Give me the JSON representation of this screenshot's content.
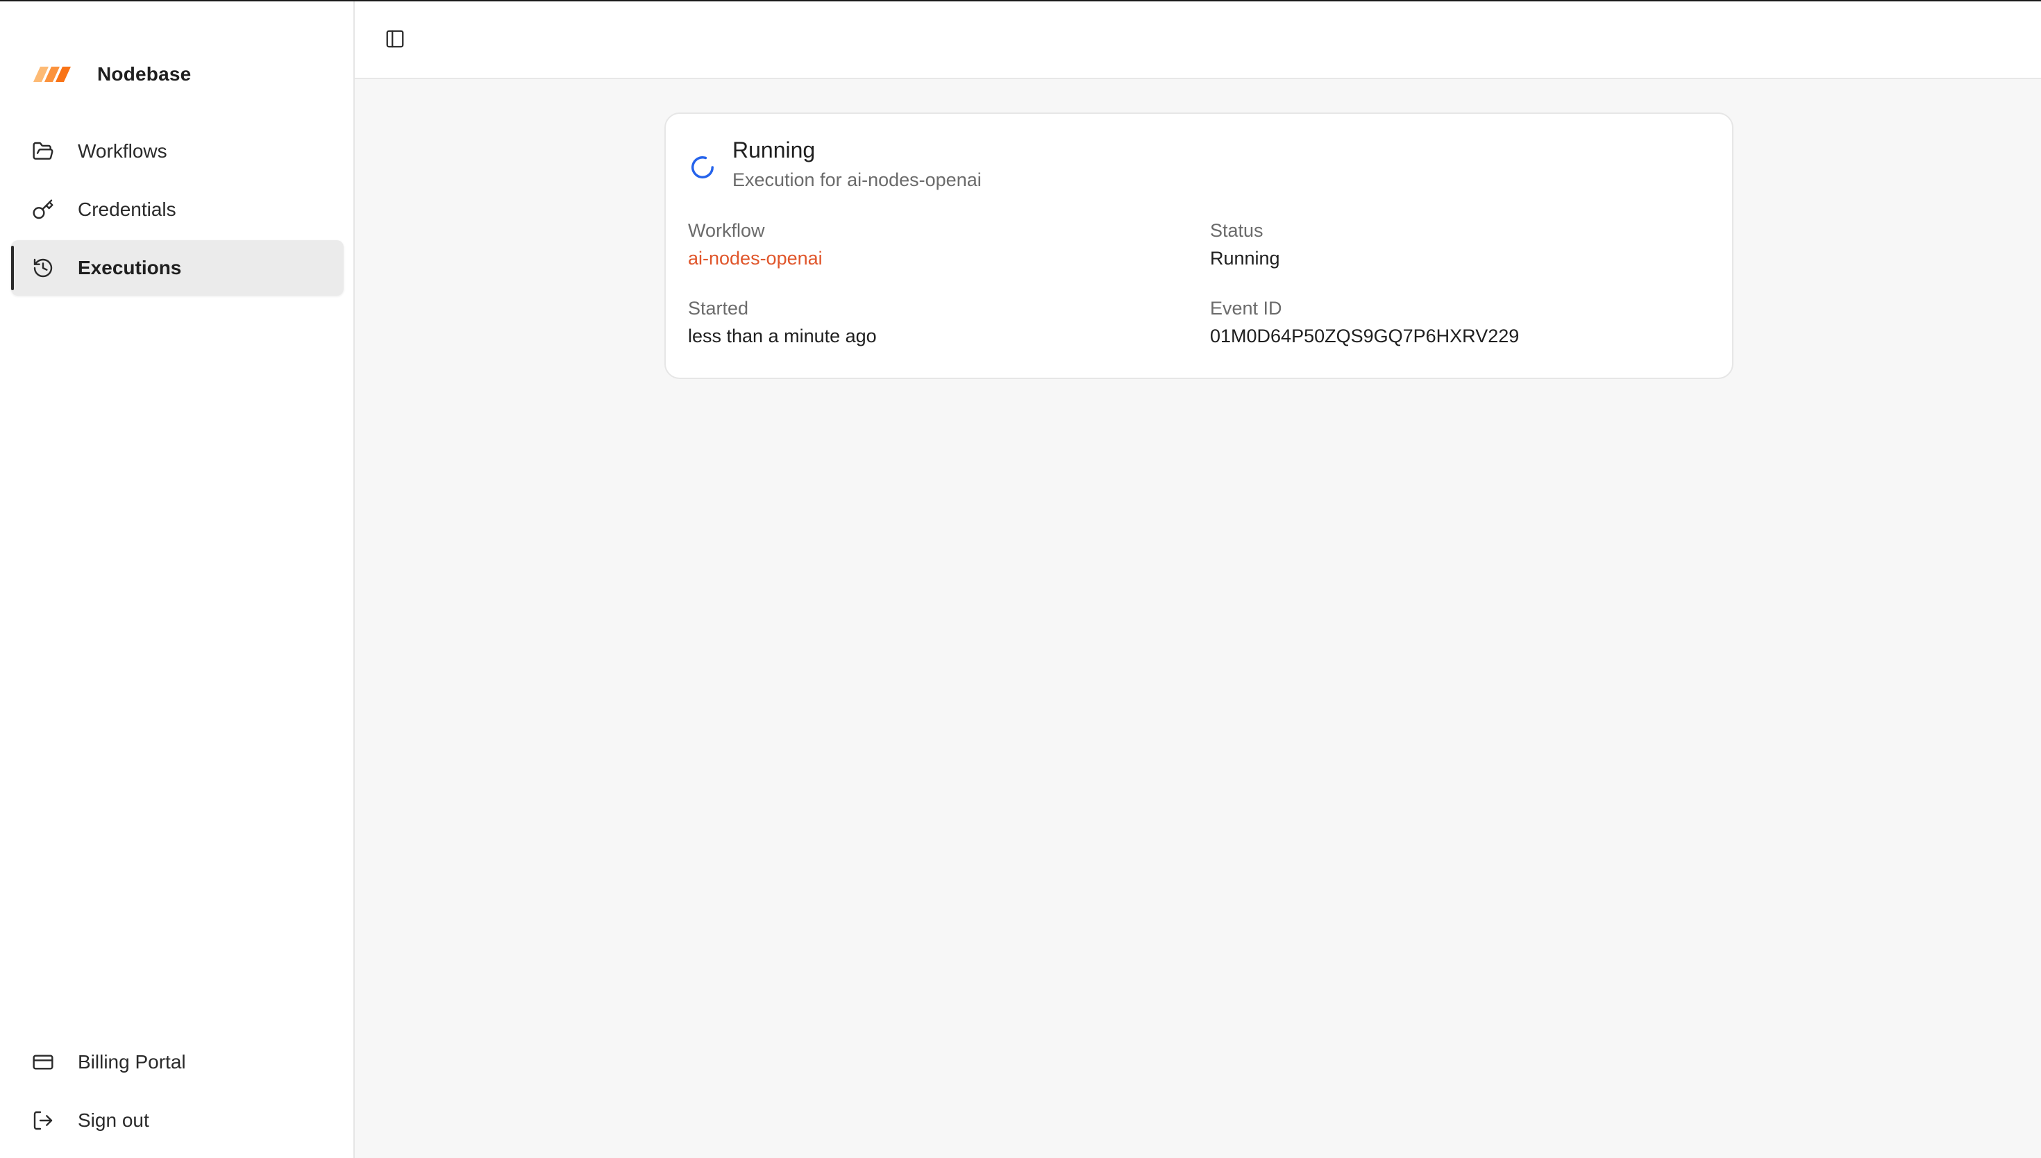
{
  "brand": {
    "name": "Nodebase",
    "logo_color": "#f97316"
  },
  "sidebar": {
    "items": [
      {
        "label": "Workflows",
        "icon": "folder-open-icon"
      },
      {
        "label": "Credentials",
        "icon": "key-icon"
      },
      {
        "label": "Executions",
        "icon": "history-icon",
        "active": true
      }
    ],
    "bottom_items": [
      {
        "label": "Billing Portal",
        "icon": "credit-card-icon"
      },
      {
        "label": "Sign out",
        "icon": "log-out-icon"
      }
    ]
  },
  "topbar": {
    "toggle_icon": "panel-left-icon"
  },
  "execution": {
    "title": "Running",
    "subtitle": "Execution for ai-nodes-openai",
    "status_icon": "spinner-icon",
    "accent_color": "#2563eb",
    "fields": {
      "workflow_label": "Workflow",
      "workflow_value": "ai-nodes-openai",
      "status_label": "Status",
      "status_value": "Running",
      "started_label": "Started",
      "started_value": "less than a minute ago",
      "event_id_label": "Event ID",
      "event_id_value": "01M0D64P50ZQS9GQ7P6HXRV229"
    },
    "link_color": "#e0562b"
  }
}
